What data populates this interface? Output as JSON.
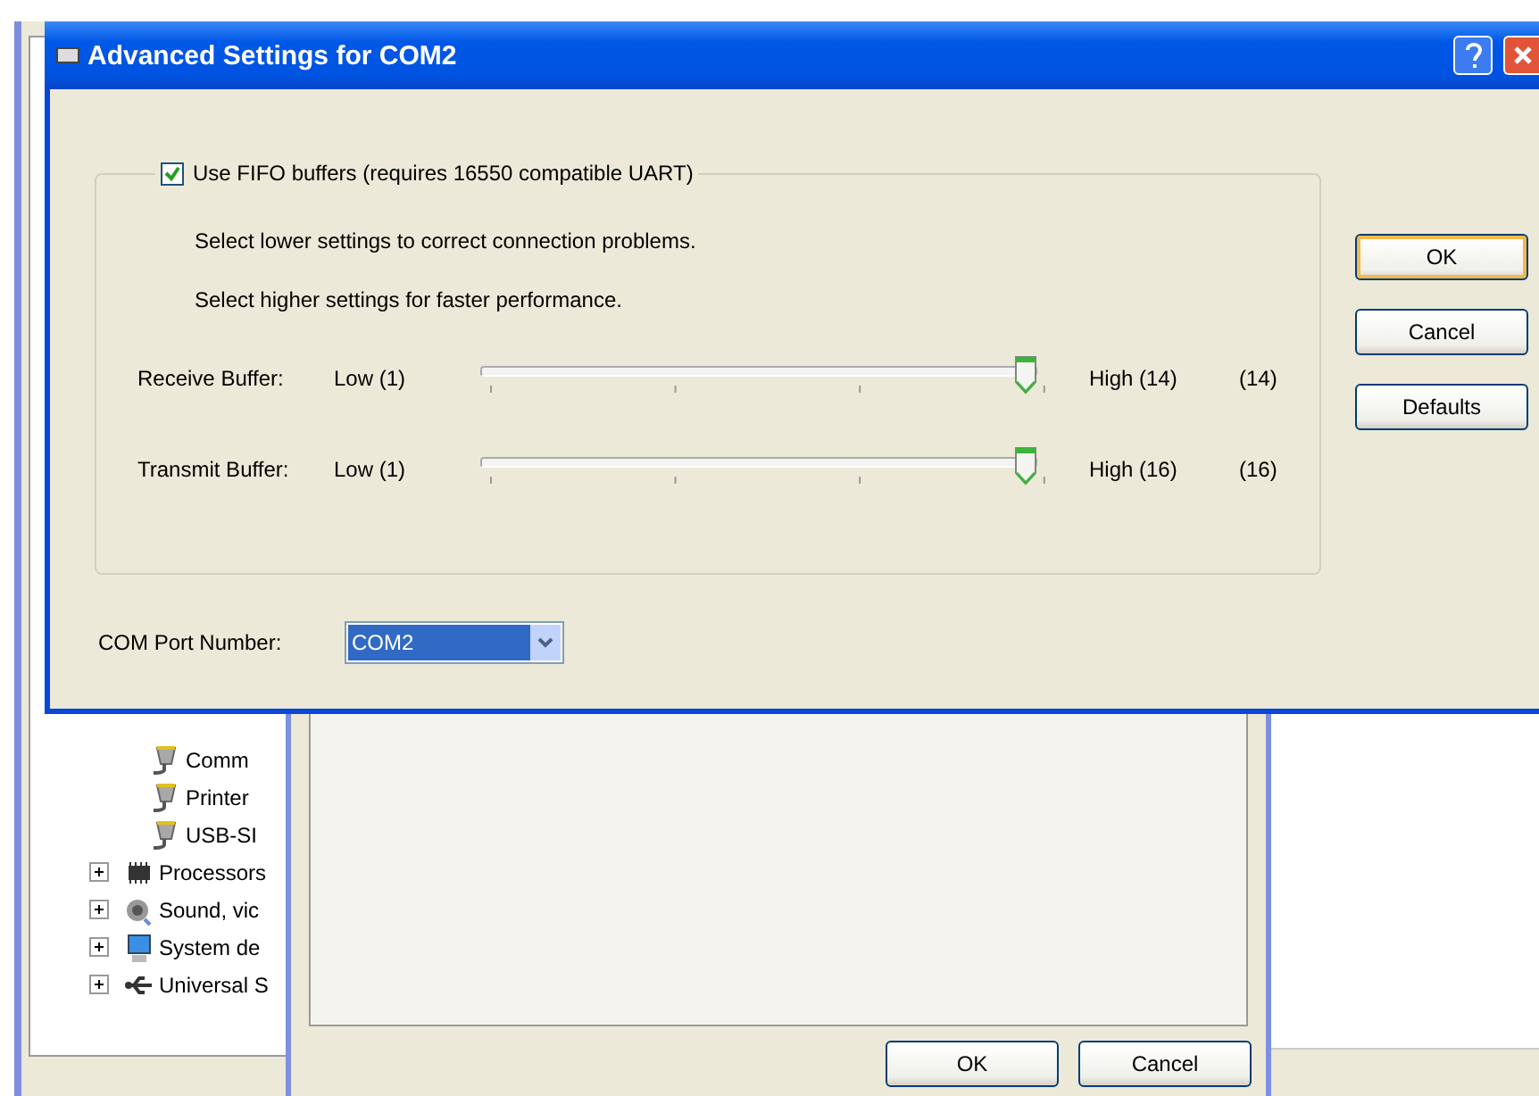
{
  "device_manager": {
    "tree_items": [
      {
        "kind": "port",
        "label": "Comm"
      },
      {
        "kind": "port",
        "label": "Printer"
      },
      {
        "kind": "port",
        "label": "USB-SI"
      },
      {
        "kind": "processor",
        "label": "Processors",
        "expanded": false
      },
      {
        "kind": "sound",
        "label": "Sound, vic",
        "expanded": false
      },
      {
        "kind": "system",
        "label": "System de",
        "expanded": false
      },
      {
        "kind": "usb",
        "label": "Universal S",
        "expanded": false
      }
    ]
  },
  "properties_window": {
    "buttons": [
      {
        "label": "OK"
      },
      {
        "label": "Cancel"
      }
    ]
  },
  "dialog": {
    "title": "Advanced Settings for COM2",
    "fifo": {
      "label": "Use FIFO buffers (requires 16550 compatible UART)",
      "checked": true
    },
    "hints": [
      "Select lower settings to correct connection problems.",
      "Select higher settings for faster performance."
    ],
    "buffers": [
      {
        "label": "Receive Buffer:",
        "low": "Low (1)",
        "high": "High (14)",
        "value": "(14)",
        "level": 1
      },
      {
        "label": "Transmit Buffer:",
        "low": "Low (1)",
        "high": "High (16)",
        "value": "(16)",
        "level": 1
      }
    ],
    "com_port": {
      "label": "COM Port Number:",
      "value": "COM2"
    },
    "buttons": [
      {
        "label": "OK",
        "default": true
      },
      {
        "label": "Cancel",
        "default": false
      },
      {
        "label": "Defaults",
        "default": false
      }
    ]
  }
}
